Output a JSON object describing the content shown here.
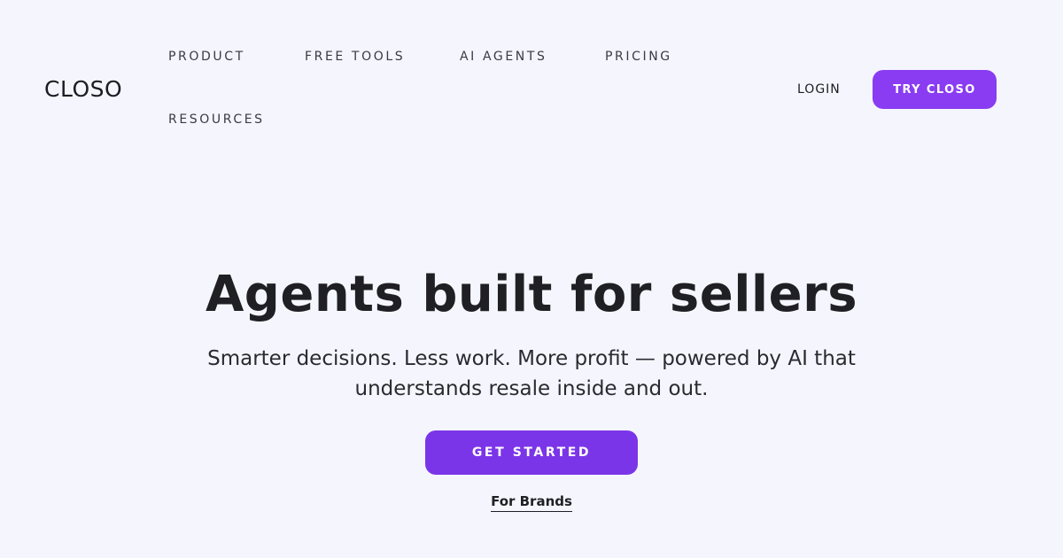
{
  "header": {
    "logo": "CLOSO",
    "nav": [
      {
        "label": "PRODUCT"
      },
      {
        "label": "FREE TOOLS"
      },
      {
        "label": "AI AGENTS"
      },
      {
        "label": "PRICING"
      },
      {
        "label": "RESOURCES"
      }
    ],
    "login_label": "LOGIN",
    "try_label": "TRY CLOSO"
  },
  "hero": {
    "title": "Agents built for sellers",
    "subtitle": "Smarter decisions. Less work. More profit — powered by AI that understands resale inside and out.",
    "cta_label": "GET STARTED",
    "secondary_link": "For Brands"
  },
  "colors": {
    "background": "#f5f6fd",
    "accent": "#8a3cf2",
    "cta": "#7b35e8",
    "text": "#1f1f24"
  }
}
